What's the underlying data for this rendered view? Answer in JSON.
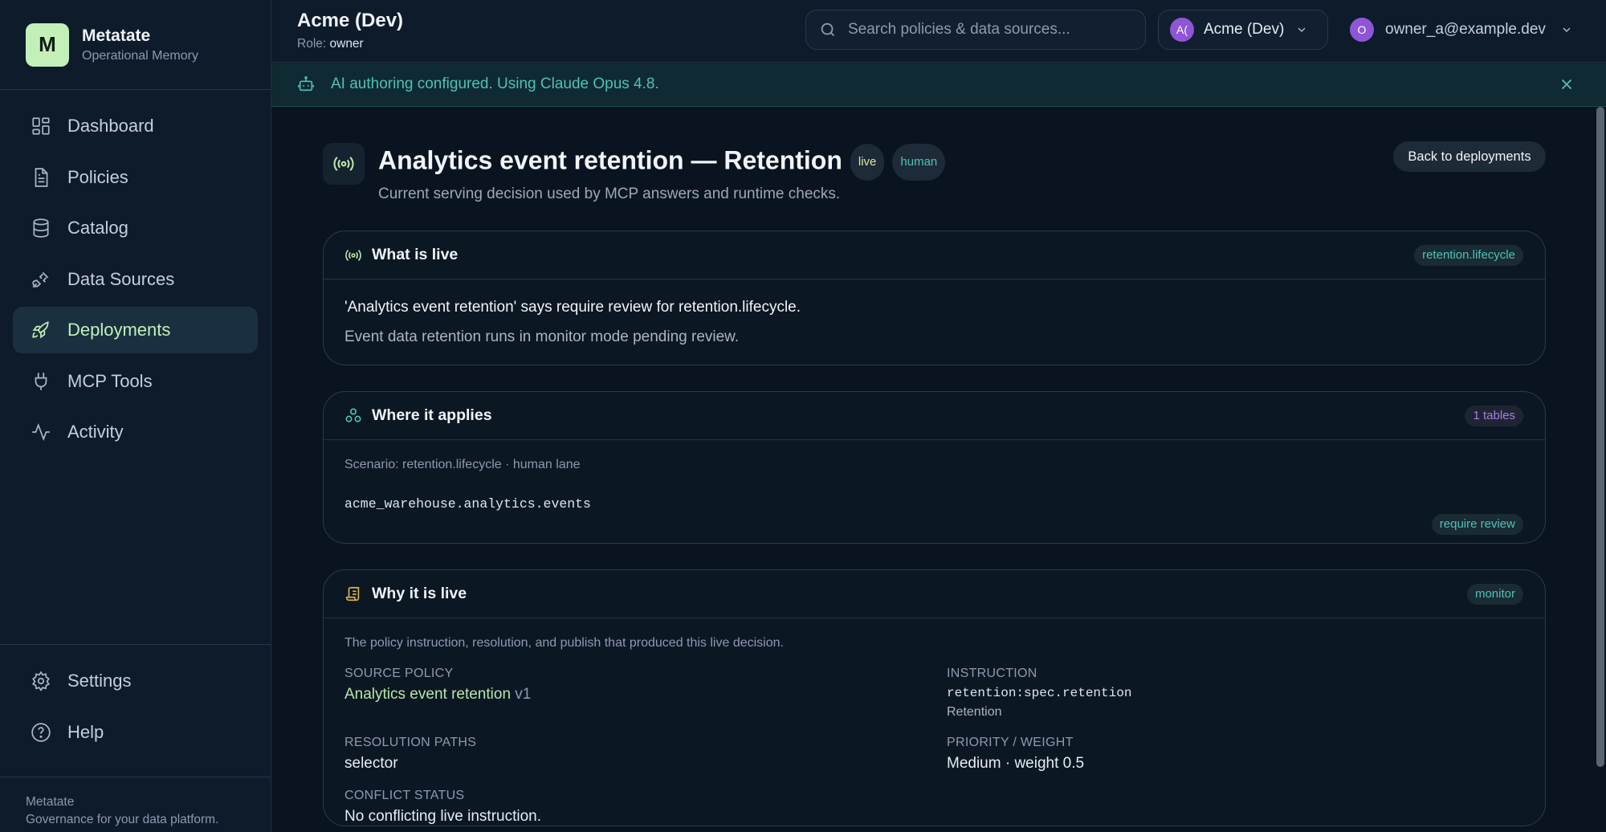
{
  "brand": {
    "logo": "M",
    "name": "Metatate",
    "subtitle": "Operational Memory"
  },
  "nav": {
    "items": [
      {
        "label": "Dashboard",
        "icon": "dashboard-icon",
        "active": false
      },
      {
        "label": "Policies",
        "icon": "document-icon",
        "active": false
      },
      {
        "label": "Catalog",
        "icon": "database-icon",
        "active": false
      },
      {
        "label": "Data Sources",
        "icon": "plug-icon",
        "active": false
      },
      {
        "label": "Deployments",
        "icon": "rocket-icon",
        "active": true
      },
      {
        "label": "MCP Tools",
        "icon": "plug-alt-icon",
        "active": false
      },
      {
        "label": "Activity",
        "icon": "activity-icon",
        "active": false
      }
    ],
    "bottom": [
      {
        "label": "Settings",
        "icon": "gear-icon"
      },
      {
        "label": "Help",
        "icon": "help-icon"
      }
    ]
  },
  "footer": {
    "line1": "Metatate",
    "line2": "Governance for your data platform."
  },
  "topbar": {
    "org_title": "Acme (Dev)",
    "role_label": "Role:",
    "role_value": "owner",
    "search_placeholder": "Search policies & data sources...",
    "org_switch": {
      "avatar": "A(",
      "label": "Acme (Dev)"
    },
    "user": {
      "avatar": "O",
      "email": "owner_a@example.dev"
    }
  },
  "banner": {
    "text": "AI authoring configured. Using Claude Opus 4.8."
  },
  "page": {
    "title": "Analytics event retention — Retention",
    "badges": {
      "live": "live",
      "human": "human"
    },
    "subtitle": "Current serving decision used by MCP answers and runtime checks.",
    "back_label": "Back to deployments"
  },
  "cards": {
    "live": {
      "title": "What is live",
      "tag": "retention.lifecycle",
      "headline": "'Analytics event retention' says require review for retention.lifecycle.",
      "detail": "Event data retention runs in monitor mode pending review."
    },
    "applies": {
      "title": "Where it applies",
      "tag": "1 tables",
      "scenario": "Scenario: retention.lifecycle · human lane",
      "table": "acme_warehouse.analytics.events",
      "table_tag": "require review"
    },
    "why": {
      "title": "Why it is live",
      "tag": "monitor",
      "intro": "The policy instruction, resolution, and publish that produced this live decision.",
      "source_policy_label": "SOURCE POLICY",
      "source_policy_name": "Analytics event retention",
      "source_policy_version": "v1",
      "instruction_label": "INSTRUCTION",
      "instruction_code": "retention:spec.retention",
      "instruction_name": "Retention",
      "resolution_label": "RESOLUTION PATHS",
      "resolution_value": "selector",
      "priority_label": "PRIORITY / WEIGHT",
      "priority_value": "Medium · weight 0.5",
      "conflict_label": "CONFLICT STATUS",
      "conflict_value": "No conflicting live instruction."
    }
  },
  "colors": {
    "accent": "#c3f0b8",
    "teal": "#4fc1b4",
    "purple": "#a87de8",
    "background": "#0a1420"
  }
}
